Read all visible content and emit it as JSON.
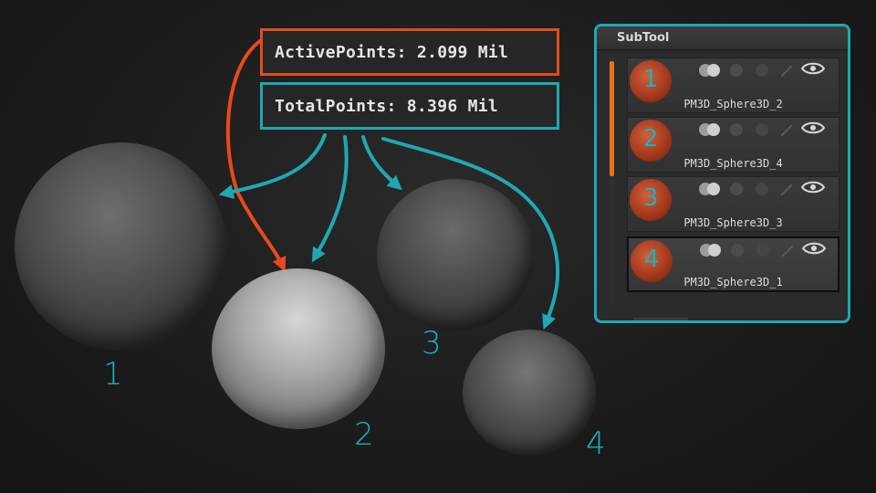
{
  "stats": {
    "active_points": "ActivePoints: 2.099 Mil",
    "total_points": "TotalPoints: 8.396 Mil"
  },
  "spheres": {
    "labels": [
      "1",
      "2",
      "3",
      "4"
    ]
  },
  "subtool": {
    "title": "SubTool",
    "items": [
      {
        "number": "1",
        "name": "PM3D_Sphere3D_2",
        "selected": false
      },
      {
        "number": "2",
        "name": "PM3D_Sphere3D_4",
        "selected": false
      },
      {
        "number": "3",
        "name": "PM3D_Sphere3D_3",
        "selected": false
      },
      {
        "number": "4",
        "name": "PM3D_Sphere3D_1",
        "selected": true
      }
    ]
  },
  "colors": {
    "active_highlight": "#e64a1e",
    "total_highlight": "#1fa8b3",
    "annotation_text": "#1fb0bd",
    "scroll_thumb": "#e8731e",
    "thumbnail_material": "#a63a1c"
  },
  "icons": [
    "eye-icon",
    "paint-brush-icon",
    "solo-toggle-icon",
    "polyframe-icon"
  ]
}
